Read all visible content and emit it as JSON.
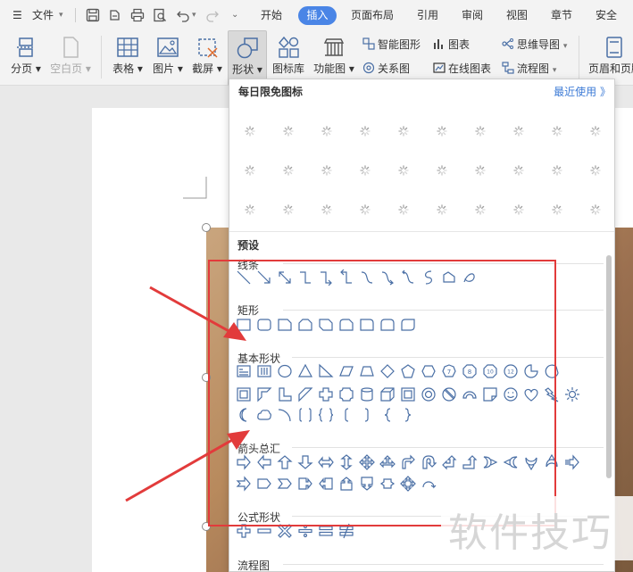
{
  "menu": {
    "file": "文件",
    "tabs": [
      "开始",
      "插入",
      "页面布局",
      "引用",
      "审阅",
      "视图",
      "章节",
      "安全"
    ]
  },
  "ribbon": {
    "page_break": "分页",
    "blank_page": "空白页",
    "table": "表格",
    "picture": "图片",
    "screenshot": "截屏",
    "shape": "形状",
    "icon_library": "图标库",
    "function_chart": "功能图",
    "smart_shape": "智能图形",
    "chart": "图表",
    "mind_map": "思维导图",
    "relation_chart": "关系图",
    "online_chart": "在线图表",
    "flowchart": "流程图",
    "header_footer": "页眉和页脚"
  },
  "panel": {
    "daily_free_icons": "每日限免图标",
    "recent_used": "最近使用 》",
    "preset": "预设",
    "sections": {
      "lines": "线条",
      "rectangles": "矩形",
      "basic_shapes": "基本形状",
      "arrows": "箭头总汇",
      "equation_shapes": "公式形状",
      "flowchart": "流程图"
    }
  },
  "watermark": "软件技巧",
  "colors": {
    "accent": "#4a85e6",
    "annotation_red": "#e23b3b",
    "shape_stroke": "#4a6fa5"
  }
}
